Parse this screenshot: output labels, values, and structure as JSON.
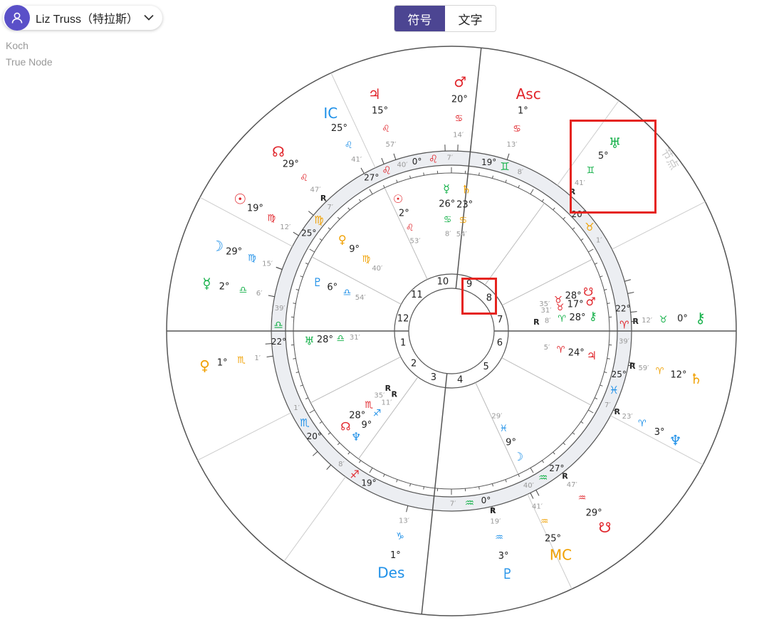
{
  "profile": {
    "name": "Liz Truss（特拉斯）"
  },
  "house_system": "Koch",
  "node_type": "True Node",
  "view_toggle": {
    "symbol_label": "符号",
    "text_label": "文字",
    "active": "symbol"
  },
  "colors": {
    "fire": "#e0242a",
    "earth": "#f0a000",
    "air": "#16b14a",
    "water": "#1e90e8",
    "line": "#555555",
    "ring": "#eceef2"
  },
  "chart_data": {
    "type": "astrology-bi-wheel",
    "signs": [
      {
        "name": "leo",
        "glyph": "♌",
        "start": "0°",
        "min": "7′",
        "color": "fire"
      },
      {
        "name": "virgo",
        "glyph": "♍",
        "start": "25°",
        "min": "7′",
        "color": "earth"
      },
      {
        "name": "libra",
        "glyph": "♎",
        "start": "22°",
        "min": "39′",
        "color": "air"
      },
      {
        "name": "scorpio",
        "glyph": "♏",
        "start": "20°",
        "min": "1′",
        "color": "water"
      },
      {
        "name": "sagittarius",
        "glyph": "♐",
        "start": "19°",
        "min": "8′",
        "color": "fire"
      },
      {
        "name": "aquarius",
        "glyph": "♒",
        "start": "0°",
        "min": "7′",
        "color": "air"
      },
      {
        "name": "aquarius-2",
        "glyph": "♒",
        "start": "27°",
        "min": "40′",
        "color": "air"
      },
      {
        "name": "pisces",
        "glyph": "♓",
        "start": "25°",
        "min": "7′",
        "color": "water"
      },
      {
        "name": "aries",
        "glyph": "♈",
        "start": "22°",
        "min": "39′",
        "color": "fire"
      },
      {
        "name": "taurus",
        "glyph": "♉",
        "start": "20°",
        "min": "1′",
        "color": "earth"
      },
      {
        "name": "gemini",
        "glyph": "♊",
        "start": "19°",
        "min": "8′",
        "color": "air"
      },
      {
        "name": "leo-2",
        "glyph": "♌",
        "start": "27°",
        "min": "40′",
        "color": "fire"
      }
    ],
    "houses": [
      "1",
      "2",
      "3",
      "4",
      "5",
      "6",
      "7",
      "8",
      "9",
      "10",
      "11",
      "12"
    ],
    "outer_points": [
      {
        "name": "mars",
        "glyph": "♂",
        "deg": "20°",
        "sign": "♋",
        "min": "14′",
        "color": "fire",
        "r": ""
      },
      {
        "name": "asc",
        "glyph": "Asc",
        "deg": "1°",
        "sign": "♋",
        "min": "13′",
        "color": "fire",
        "r": ""
      },
      {
        "name": "uranus",
        "glyph": "♅",
        "deg": "5°",
        "sign": "♊",
        "min": "41′",
        "color": "air",
        "r": "R"
      },
      {
        "name": "chiron",
        "glyph": "⚷",
        "deg": "0°",
        "sign": "♉",
        "min": "12′",
        "color": "air",
        "r": "R"
      },
      {
        "name": "saturn",
        "glyph": "♄",
        "deg": "12°",
        "sign": "♈",
        "min": "59′",
        "color": "earth",
        "r": "R"
      },
      {
        "name": "neptune",
        "glyph": "♆",
        "deg": "3°",
        "sign": "♈",
        "min": "23′",
        "color": "water",
        "r": "R"
      },
      {
        "name": "south-node",
        "glyph": "☋",
        "deg": "29°",
        "sign": "♒",
        "min": "47′",
        "color": "fire",
        "r": "R"
      },
      {
        "name": "mc",
        "glyph": "MC",
        "deg": "25°",
        "sign": "♒",
        "min": "41′",
        "color": "earth",
        "r": ""
      },
      {
        "name": "pluto",
        "glyph": "♇",
        "deg": "3°",
        "sign": "♒",
        "min": "19′",
        "color": "water",
        "r": "R"
      },
      {
        "name": "des",
        "glyph": "Des",
        "deg": "1°",
        "sign": "♑",
        "min": "13′",
        "color": "water",
        "r": ""
      },
      {
        "name": "venus",
        "glyph": "♀",
        "deg": "1°",
        "sign": "♏",
        "min": "1′",
        "color": "earth",
        "r": ""
      },
      {
        "name": "mercury",
        "glyph": "☿",
        "deg": "2°",
        "sign": "♎",
        "min": "6′",
        "color": "air",
        "r": ""
      },
      {
        "name": "moon",
        "glyph": "☽",
        "deg": "29°",
        "sign": "♍",
        "min": "15′",
        "color": "water",
        "r": ""
      },
      {
        "name": "sun",
        "glyph": "☉",
        "deg": "19°",
        "sign": "♍",
        "min": "12′",
        "color": "fire",
        "r": ""
      },
      {
        "name": "north-node",
        "glyph": "☊",
        "deg": "29°",
        "sign": "♌",
        "min": "47′",
        "color": "fire",
        "r": "R"
      },
      {
        "name": "ic",
        "glyph": "IC",
        "deg": "25°",
        "sign": "♌",
        "min": "41′",
        "color": "water",
        "r": ""
      },
      {
        "name": "jupiter",
        "glyph": "♃",
        "deg": "15°",
        "sign": "♌",
        "min": "57′",
        "color": "fire",
        "r": ""
      }
    ],
    "inner_points": [
      {
        "name": "sun",
        "glyph": "☉",
        "deg": "2°",
        "sign": "♌",
        "min": "53′",
        "color": "fire",
        "r": ""
      },
      {
        "name": "mercury",
        "glyph": "☿",
        "deg": "26°",
        "sign": "♋",
        "min": "8′",
        "color": "air",
        "r": ""
      },
      {
        "name": "saturn",
        "glyph": "♄",
        "deg": "23°",
        "sign": "♋",
        "min": "54′",
        "color": "earth",
        "r": ""
      },
      {
        "name": "venus",
        "glyph": "♀",
        "deg": "9°",
        "sign": "♍",
        "min": "40′",
        "color": "earth",
        "r": ""
      },
      {
        "name": "pluto",
        "glyph": "♇",
        "deg": "6°",
        "sign": "♎",
        "min": "54′",
        "color": "water",
        "r": ""
      },
      {
        "name": "uranus",
        "glyph": "♅",
        "deg": "28°",
        "sign": "♎",
        "min": "31′",
        "color": "air",
        "r": ""
      },
      {
        "name": "north-node",
        "glyph": "☊",
        "deg": "28°",
        "sign": "♏",
        "min": "35′",
        "color": "fire",
        "r": "R"
      },
      {
        "name": "neptune",
        "glyph": "♆",
        "deg": "9°",
        "sign": "♐",
        "min": "11′",
        "color": "water",
        "r": "R"
      },
      {
        "name": "moon",
        "glyph": "☽",
        "deg": "9°",
        "sign": "♓",
        "min": "29′",
        "color": "water",
        "r": ""
      },
      {
        "name": "south-node",
        "glyph": "☋",
        "deg": "28°",
        "sign": "♉",
        "min": "35′",
        "color": "fire",
        "r": ""
      },
      {
        "name": "mars",
        "glyph": "♂",
        "deg": "17°",
        "sign": "♉",
        "min": "31′",
        "color": "fire",
        "r": ""
      },
      {
        "name": "chiron",
        "glyph": "⚷",
        "deg": "28°",
        "sign": "♈",
        "min": "8′",
        "color": "air",
        "r": "R"
      },
      {
        "name": "jupiter",
        "glyph": "♃",
        "deg": "24°",
        "sign": "♈",
        "min": "5′",
        "color": "fire",
        "r": ""
      }
    ],
    "side_label": "节点"
  }
}
